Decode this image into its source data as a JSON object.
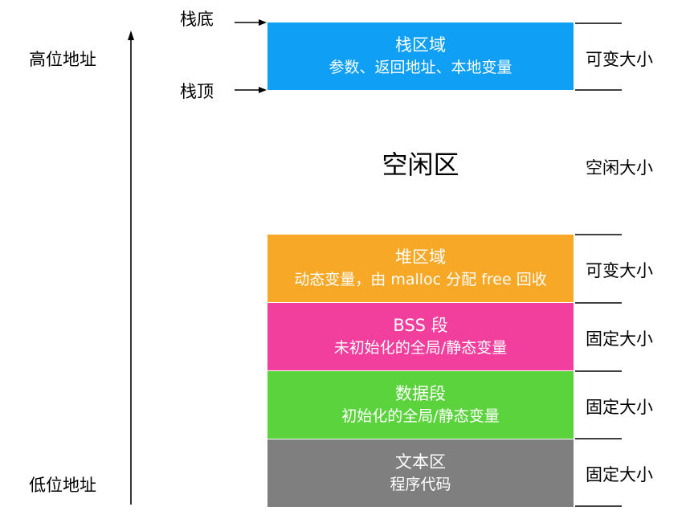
{
  "address": {
    "high": "高位地址",
    "low": "低位地址"
  },
  "pointers": {
    "stack_bottom": "栈底",
    "stack_top": "栈顶"
  },
  "segments": {
    "stack": {
      "title": "栈区域",
      "desc": "参数、返回地址、本地变量",
      "size": "可变大小",
      "color": "#0f9ff5"
    },
    "free": {
      "title": "空闲区",
      "size": "空闲大小"
    },
    "heap": {
      "title": "堆区域",
      "desc": "动态变量，由 malloc 分配 free 回收",
      "size": "可变大小",
      "color": "#f6a826"
    },
    "bss": {
      "title": "BSS 段",
      "desc": "未初始化的全局/静态变量",
      "size": "固定大小",
      "color": "#f23e9c"
    },
    "data": {
      "title": "数据段",
      "desc": "初始化的全局/静态变量",
      "size": "固定大小",
      "color": "#5bd33c"
    },
    "text": {
      "title": "文本区",
      "desc": "程序代码",
      "size": "固定大小",
      "color": "#7f7f7f"
    }
  }
}
